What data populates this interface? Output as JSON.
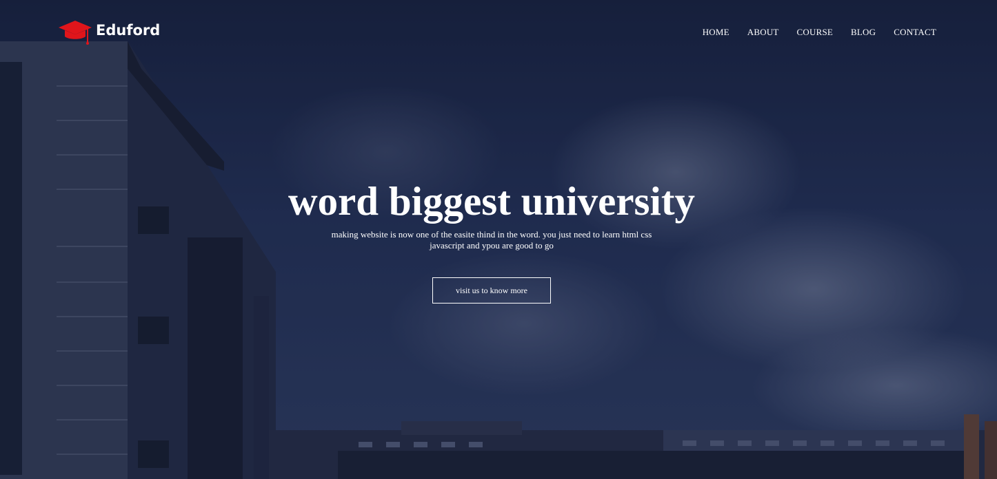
{
  "brand": {
    "name": "Eduford",
    "icon": "graduation-cap-icon",
    "icon_color": "#e0151b"
  },
  "nav": {
    "items": [
      {
        "label": "HOME"
      },
      {
        "label": "ABOUT"
      },
      {
        "label": "COURSE"
      },
      {
        "label": "BLOG"
      },
      {
        "label": "CONTACT"
      }
    ]
  },
  "hero": {
    "title": "word biggest university",
    "subtitle": "making website is now one of the easite thind in the word. you just need to learn html css javascript and ypou are good to go",
    "cta_label": "visit us to know more"
  },
  "colors": {
    "text": "#ffffff",
    "overlay": "#1b2541"
  }
}
